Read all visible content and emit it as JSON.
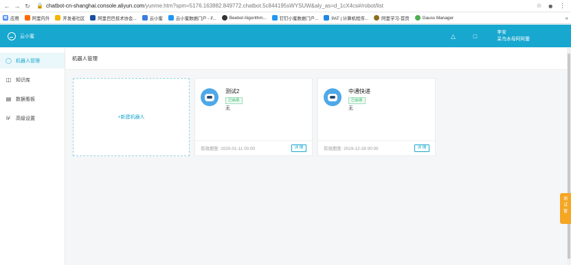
{
  "browser": {
    "host": "chatbot-cn-shanghai.console.aliyun.com",
    "path": "/yunme.htm?spm=5176.163882.849772.chatbot.5c844195sWYSUW&aly_as=d_1cX4cs#/robot/list",
    "bookmarks": [
      {
        "label": "应用",
        "color": "#4285f4"
      },
      {
        "label": "阿里内外",
        "color": "#ff6a00"
      },
      {
        "label": "开发者社区",
        "color": "#f4b400"
      },
      {
        "label": "阿里巴巴技术协会...",
        "color": "#1a4fa0"
      },
      {
        "label": "云小蜜",
        "color": "#3b7ddd"
      },
      {
        "label": "云小蜜数据门户 - F...",
        "color": "#2196f3"
      },
      {
        "label": "Beebot Algorithm...",
        "color": "#333333"
      },
      {
        "label": "钉钉小蜜数据门户...",
        "color": "#2196f3"
      },
      {
        "label": "PAT | 计算机程序...",
        "color": "#1e88e5"
      },
      {
        "label": "阿里学习-首页",
        "color": "#8d6e1e"
      },
      {
        "label": "Gauss Manager",
        "color": "#4caf50"
      }
    ]
  },
  "header": {
    "app_name": "云小蜜",
    "user_name": "李安",
    "user_org": "呆鸟水母阿阿蕾"
  },
  "sidebar": {
    "items": [
      {
        "label": "机器人管理",
        "icon": "robot-icon"
      },
      {
        "label": "知识库",
        "icon": "book-icon"
      },
      {
        "label": "数据看板",
        "icon": "chart-icon"
      },
      {
        "label": "高级设置",
        "icon": "settings-icon"
      }
    ]
  },
  "main": {
    "title": "机器人管理",
    "new_bot_label": "+新建机器人",
    "bots": [
      {
        "name": "测试2",
        "status": "已启用",
        "desc": "无",
        "expiry": "有效期至: 2020-01-11 00:00",
        "action": "详 情"
      },
      {
        "name": "中通快递",
        "status": "已启用",
        "desc": "无",
        "expiry": "有效期至: 2019-12-28 00:00",
        "action": "详 情"
      }
    ]
  },
  "float_tab": {
    "label": "测试窗"
  },
  "colors": {
    "brand": "#17a7cf",
    "status_ok": "#2fb86a",
    "float_tab": "#f5a623"
  }
}
